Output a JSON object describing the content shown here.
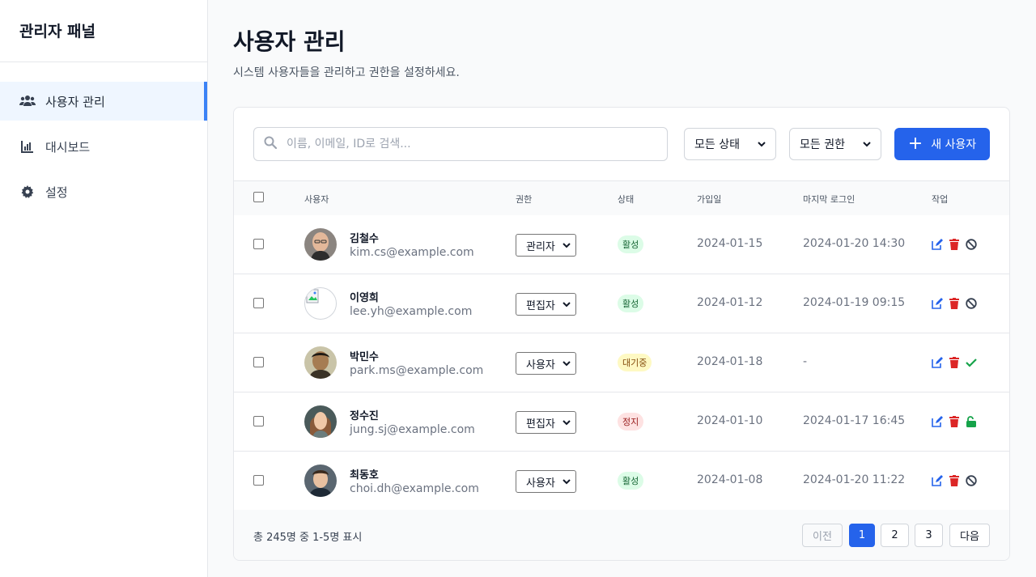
{
  "sidebar": {
    "title": "관리자 패널",
    "items": [
      {
        "label": "사용자 관리",
        "icon": "users-icon",
        "active": true
      },
      {
        "label": "대시보드",
        "icon": "chart-icon",
        "active": false
      },
      {
        "label": "설정",
        "icon": "gear-icon",
        "active": false
      }
    ]
  },
  "header": {
    "title": "사용자 관리",
    "subtitle": "시스템 사용자들을 관리하고 권한을 설정하세요."
  },
  "toolbar": {
    "search_placeholder": "이름, 이메일, ID로 검색...",
    "status_filter": "모든 상태",
    "role_filter": "모든 권한",
    "new_user_label": "새 사용자"
  },
  "table": {
    "columns": [
      "사용자",
      "권한",
      "상태",
      "가입일",
      "마지막 로그인",
      "작업"
    ],
    "rows": [
      {
        "name": "김철수",
        "email": "kim.cs@example.com",
        "role": "관리자",
        "status": "활성",
        "status_type": "active",
        "joined": "2024-01-15",
        "last_login": "2024-01-20 14:30",
        "third_action": "ban-icon"
      },
      {
        "name": "이영희",
        "email": "lee.yh@example.com",
        "role": "편집자",
        "status": "활성",
        "status_type": "active",
        "joined": "2024-01-12",
        "last_login": "2024-01-19 09:15",
        "third_action": "ban-icon"
      },
      {
        "name": "박민수",
        "email": "park.ms@example.com",
        "role": "사용자",
        "status": "대기중",
        "status_type": "pending",
        "joined": "2024-01-18",
        "last_login": "-",
        "third_action": "check-icon"
      },
      {
        "name": "정수진",
        "email": "jung.sj@example.com",
        "role": "편집자",
        "status": "정지",
        "status_type": "suspended",
        "joined": "2024-01-10",
        "last_login": "2024-01-17 16:45",
        "third_action": "unlock-icon"
      },
      {
        "name": "최동호",
        "email": "choi.dh@example.com",
        "role": "사용자",
        "status": "활성",
        "status_type": "active",
        "joined": "2024-01-08",
        "last_login": "2024-01-20 11:22",
        "third_action": "ban-icon"
      }
    ]
  },
  "footer": {
    "summary": "총 245명 중 1-5명 표시",
    "prev_label": "이전",
    "next_label": "다음",
    "pages": [
      "1",
      "2",
      "3"
    ],
    "current_page": "1"
  },
  "colors": {
    "accent": "#2563eb",
    "active_badge": "#dcfce7",
    "pending_badge": "#fef9c3",
    "suspended_badge": "#fee2e2",
    "edit_icon": "#2563eb",
    "delete_icon": "#dc2626",
    "approve_icon": "#16a34a"
  }
}
